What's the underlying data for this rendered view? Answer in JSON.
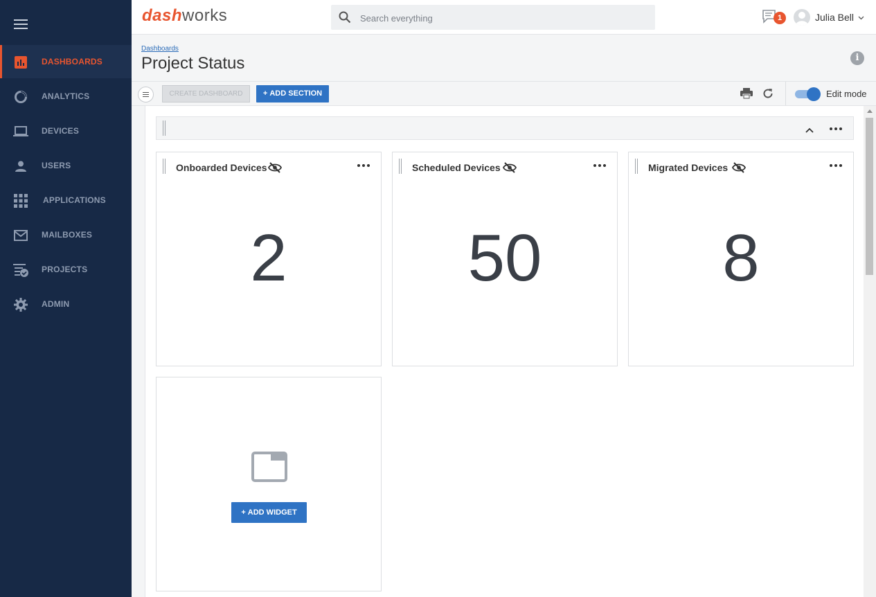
{
  "app": {
    "logo_part1": "dash",
    "logo_part2": "works"
  },
  "sidebar": {
    "items": [
      {
        "label": "DASHBOARDS",
        "icon": "bar-chart-icon",
        "active": true
      },
      {
        "label": "ANALYTICS",
        "icon": "donut-icon"
      },
      {
        "label": "DEVICES",
        "icon": "laptop-icon"
      },
      {
        "label": "USERS",
        "icon": "person-icon"
      },
      {
        "label": "APPLICATIONS",
        "icon": "grid-icon"
      },
      {
        "label": "MAILBOXES",
        "icon": "envelope-icon"
      },
      {
        "label": "PROJECTS",
        "icon": "checklist-icon"
      },
      {
        "label": "ADMIN",
        "icon": "gear-icon"
      }
    ]
  },
  "topbar": {
    "search_placeholder": "Search everything",
    "notification_count": "1",
    "user_name": "Julia Bell"
  },
  "header": {
    "breadcrumb": "Dashboards",
    "title": "Project Status"
  },
  "toolbar": {
    "create_dashboard": "CREATE DASHBOARD",
    "add_section": "ADD SECTION",
    "edit_mode_label": "Edit mode",
    "edit_mode_on": true
  },
  "widgets": [
    {
      "title": "Onboarded Devices",
      "value": "2"
    },
    {
      "title": "Scheduled Devices",
      "value": "50"
    },
    {
      "title": "Migrated Devices",
      "value": "8"
    }
  ],
  "add_widget_label": "ADD WIDGET",
  "colors": {
    "sidebar_bg": "#172946",
    "accent": "#e8552f",
    "primary_button": "#2f73c4"
  }
}
